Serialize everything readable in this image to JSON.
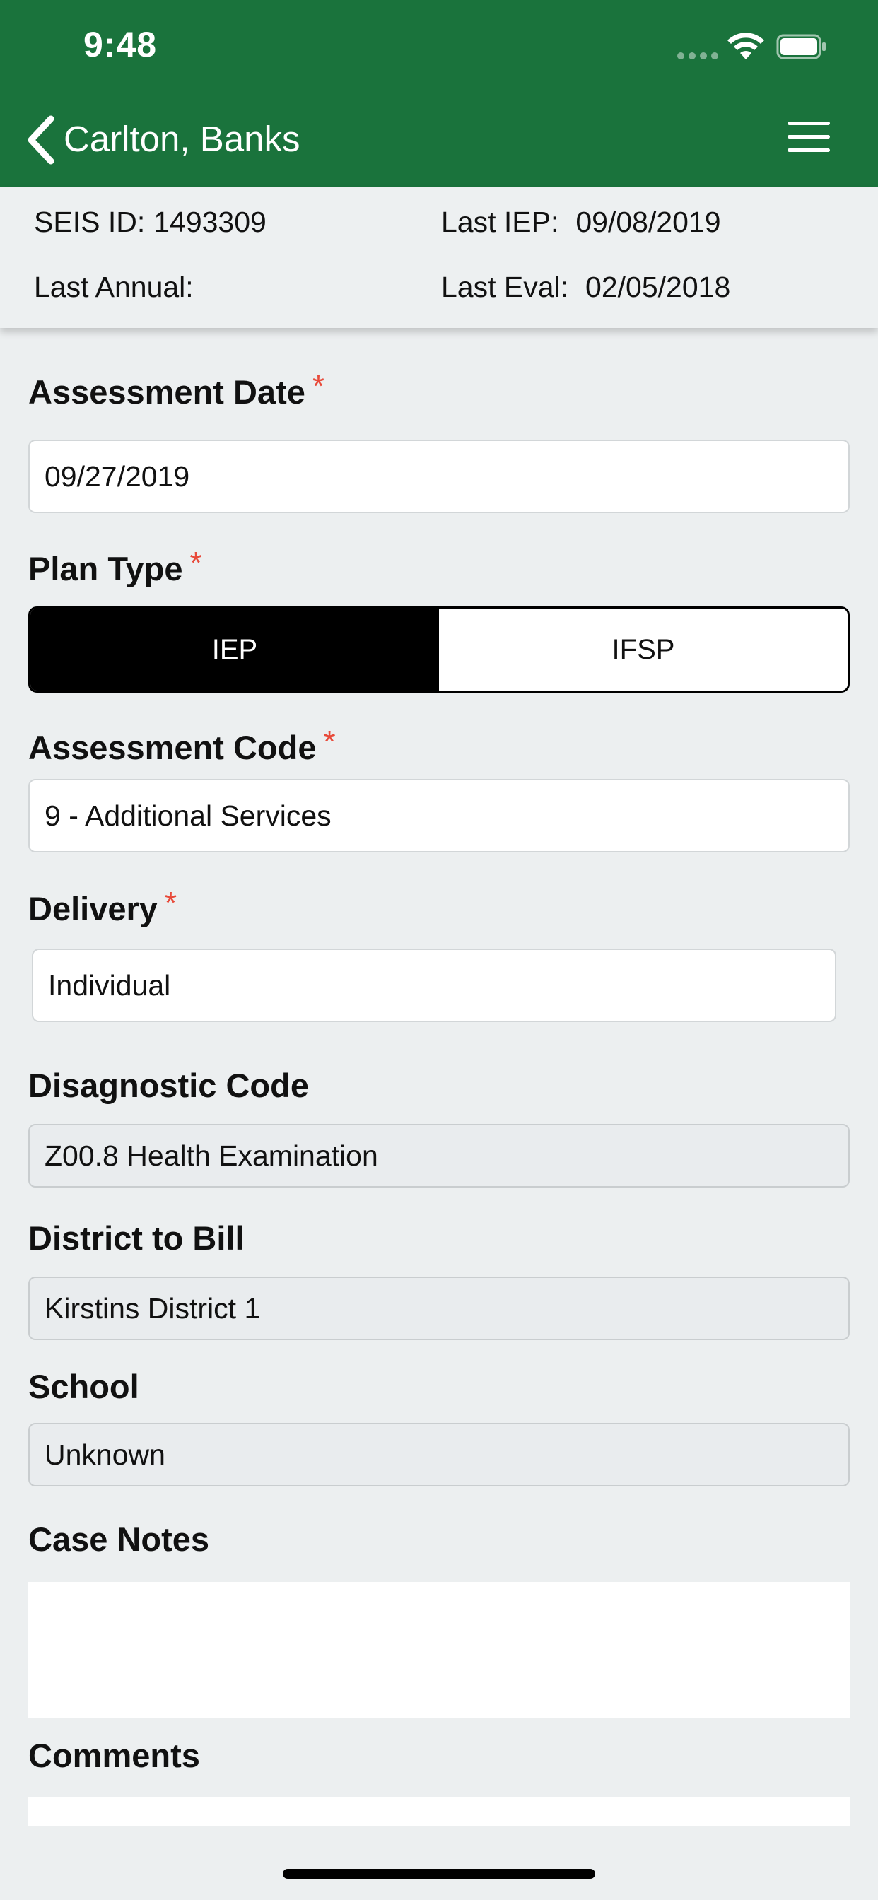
{
  "status_bar": {
    "time": "9:48",
    "icons": [
      "cellular-signal-icon",
      "wifi-icon",
      "battery-icon"
    ]
  },
  "nav": {
    "title": "Carlton, Banks",
    "back_icon": "chevron-left-icon",
    "menu_icon": "hamburger-menu-icon"
  },
  "student_info": {
    "seis_id_label": "SEIS ID:",
    "seis_id": "1493309",
    "last_iep_label": "Last IEP:",
    "last_iep": "09/08/2019",
    "last_annual_label": "Last Annual:",
    "last_annual": "",
    "last_eval_label": "Last Eval:",
    "last_eval": "02/05/2018"
  },
  "form": {
    "required_marker": "*",
    "assessment_date": {
      "label": "Assessment Date",
      "value": "09/27/2019"
    },
    "plan_type": {
      "label": "Plan Type",
      "options": [
        "IEP",
        "IFSP"
      ],
      "selected": "IEP"
    },
    "assessment_code": {
      "label": "Assessment Code",
      "value": "9 - Additional Services"
    },
    "delivery": {
      "label": "Delivery",
      "value": "Individual"
    },
    "diagnostic_code": {
      "label": "Disagnostic Code",
      "value": "Z00.8 Health Examination"
    },
    "district_to_bill": {
      "label": "District to Bill",
      "value": "Kirstins District 1"
    },
    "school": {
      "label": "School",
      "value": "Unknown"
    },
    "case_notes": {
      "label": "Case Notes",
      "value": ""
    },
    "comments": {
      "label": "Comments",
      "value": ""
    }
  },
  "colors": {
    "header_green": "#1a733c",
    "required_red": "#e84a3a",
    "page_background": "#eceff0",
    "segment_active": "#000000"
  }
}
